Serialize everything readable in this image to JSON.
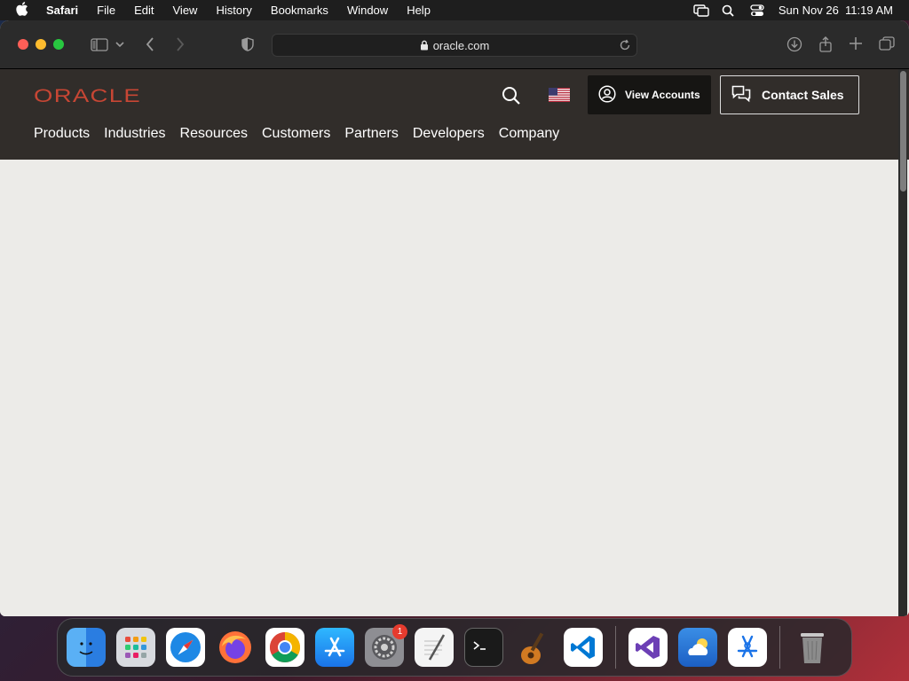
{
  "menubar": {
    "app_name": "Safari",
    "items": [
      "File",
      "Edit",
      "View",
      "History",
      "Bookmarks",
      "Window",
      "Help"
    ],
    "datetime": "Sun Nov 26  11:19 AM"
  },
  "browser": {
    "url": "oracle.com"
  },
  "oracle": {
    "logo_text": "ORACLE",
    "view_accounts": "View Accounts",
    "contact_sales": "Contact Sales",
    "nav": [
      "Products",
      "Industries",
      "Resources",
      "Customers",
      "Partners",
      "Developers",
      "Company"
    ]
  },
  "dock": {
    "settings_badge": "1"
  }
}
